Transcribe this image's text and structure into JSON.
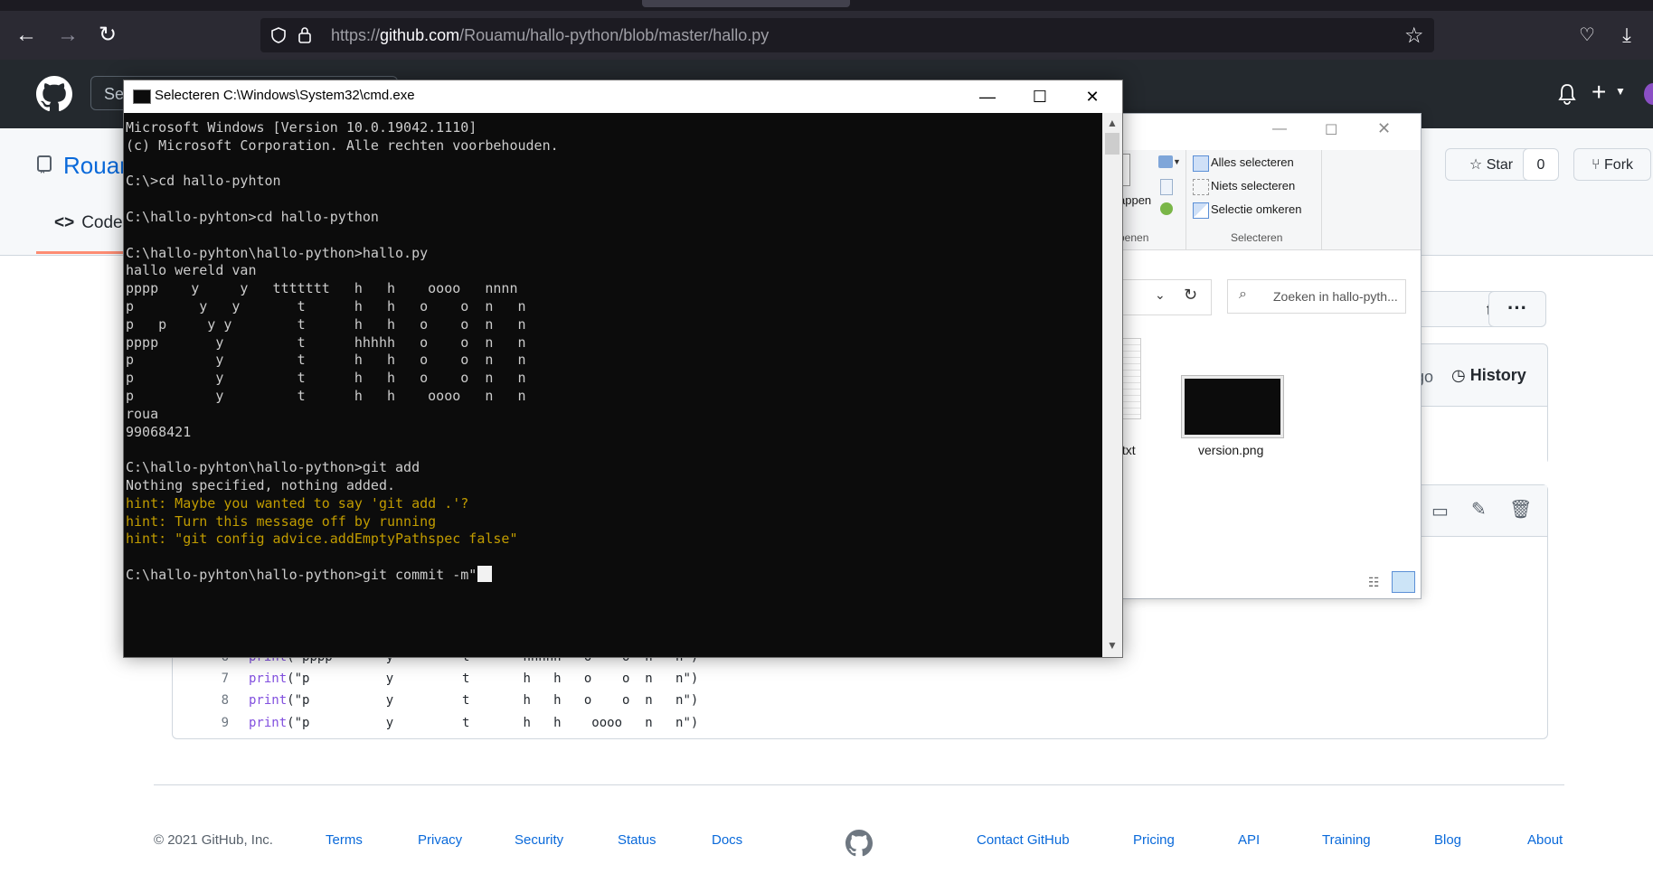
{
  "browser": {
    "url_prefix": "https://",
    "url_domain": "github.com",
    "url_path": "/Rouamu/hallo-python/blob/master/hallo.py",
    "back_icon": "←",
    "forward_icon": "→",
    "reload_icon": "↻",
    "star_icon": "☆",
    "pocket_icon": "♡",
    "download_icon": "⤓"
  },
  "github": {
    "search_placeholder": "Se",
    "repo_name": "Rouan",
    "code_tab": "Code",
    "star_label": "Star",
    "star_count": "0",
    "fork_label": "Fork",
    "go_to_file": "to file",
    "more": "···",
    "history_prefix": "go",
    "history_label": "History",
    "code_lines": [
      {
        "num": "6",
        "fn": "print",
        "args": "(\"pppp       y         t       hhhhh   o    o  n   n\")"
      },
      {
        "num": "7",
        "fn": "print",
        "args": "(\"p          y         t       h   h   o    o  n   n\")"
      },
      {
        "num": "8",
        "fn": "print",
        "args": "(\"p          y         t       h   h   o    o  n   n\")"
      },
      {
        "num": "9",
        "fn": "print",
        "args": "(\"p          y         t       h   h    oooo   n   n\")"
      }
    ],
    "footer": {
      "copyright": "© 2021 GitHub, Inc.",
      "left_links": [
        "Terms",
        "Privacy",
        "Security",
        "Status",
        "Docs"
      ],
      "right_links": [
        "Contact GitHub",
        "Pricing",
        "API",
        "Training",
        "Blog",
        "About"
      ]
    }
  },
  "explorer": {
    "select_all": "Alles selecteren",
    "select_none": "Niets selecteren",
    "invert_selection": "Selectie omkeren",
    "group_select": "Selecteren",
    "group_open_partial": "penen",
    "open_partial": "appen",
    "search_placeholder": "Zoeken in hallo-pyth...",
    "file_txt": ".txt",
    "file_png": "version.png",
    "help": "?"
  },
  "cmd": {
    "title": "Selecteren C:\\Windows\\System32\\cmd.exe",
    "lines": [
      {
        "text": "Microsoft Windows [Version 10.0.19042.1110]",
        "hint": false
      },
      {
        "text": "(c) Microsoft Corporation. Alle rechten voorbehouden.",
        "hint": false
      },
      {
        "text": "",
        "hint": false
      },
      {
        "text": "C:\\>cd hallo-pyhton",
        "hint": false
      },
      {
        "text": "",
        "hint": false
      },
      {
        "text": "C:\\hallo-pyhton>cd hallo-python",
        "hint": false
      },
      {
        "text": "",
        "hint": false
      },
      {
        "text": "C:\\hallo-pyhton\\hallo-python>hallo.py",
        "hint": false
      },
      {
        "text": "hallo wereld van",
        "hint": false
      },
      {
        "text": "pppp    y     y   ttttttt   h   h    oooo   nnnn",
        "hint": false
      },
      {
        "text": "p        y   y       t      h   h   o    o  n   n",
        "hint": false
      },
      {
        "text": "p   p     y y        t      h   h   o    o  n   n",
        "hint": false
      },
      {
        "text": "pppp       y         t      hhhhh   o    o  n   n",
        "hint": false
      },
      {
        "text": "p          y         t      h   h   o    o  n   n",
        "hint": false
      },
      {
        "text": "p          y         t      h   h   o    o  n   n",
        "hint": false
      },
      {
        "text": "p          y         t      h   h    oooo   n   n",
        "hint": false
      },
      {
        "text": "roua",
        "hint": false
      },
      {
        "text": "99068421",
        "hint": false
      },
      {
        "text": "",
        "hint": false
      },
      {
        "text": "C:\\hallo-pyhton\\hallo-python>git add",
        "hint": false
      },
      {
        "text": "Nothing specified, nothing added.",
        "hint": false
      },
      {
        "text": "hint: Maybe you wanted to say 'git add .'?",
        "hint": true
      },
      {
        "text": "hint: Turn this message off by running",
        "hint": true
      },
      {
        "text": "hint: \"git config advice.addEmptyPathspec false\"",
        "hint": true
      },
      {
        "text": "",
        "hint": false
      },
      {
        "text": "C:\\hallo-pyhton\\hallo-python>git commit -m\"",
        "hint": false
      }
    ],
    "minimize": "—",
    "maximize": "☐",
    "close": "✕"
  }
}
